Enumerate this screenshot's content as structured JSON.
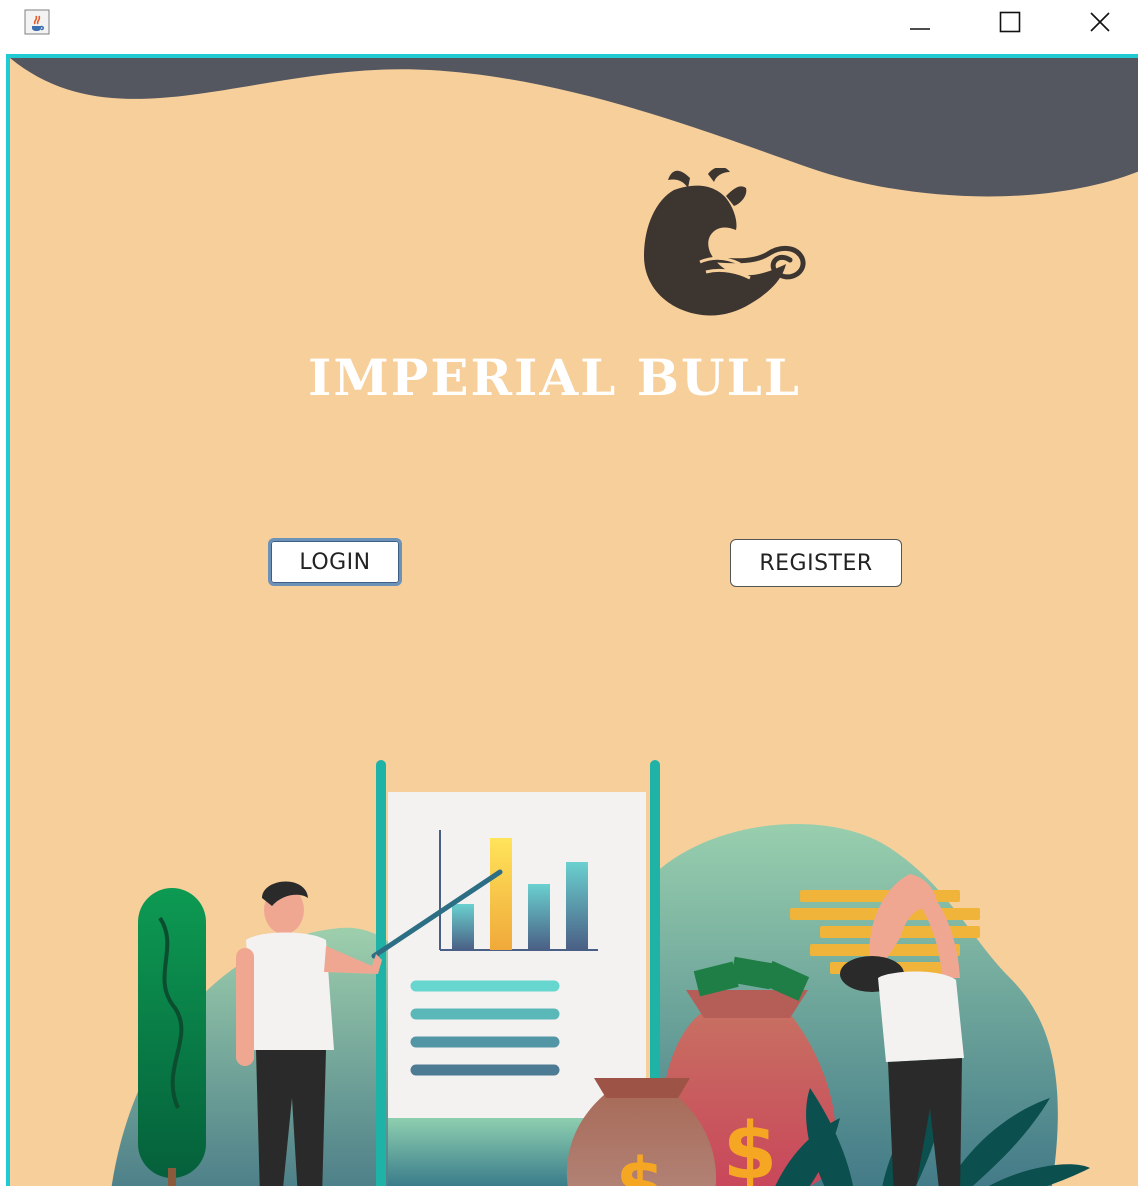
{
  "window": {
    "icons": {
      "app": "java-cup-icon",
      "minimize": "minimize-icon",
      "maximize": "maximize-icon",
      "close": "close-icon"
    }
  },
  "brand": {
    "title": "IMPERIAL BULL",
    "logo": "bull-logo-icon"
  },
  "actions": {
    "login_label": "LOGIN",
    "register_label": "REGISTER"
  },
  "colors": {
    "background": "#f6cf9b",
    "wave": "#545760",
    "accent_border": "#1fcad3",
    "bull": "#3d3530"
  }
}
